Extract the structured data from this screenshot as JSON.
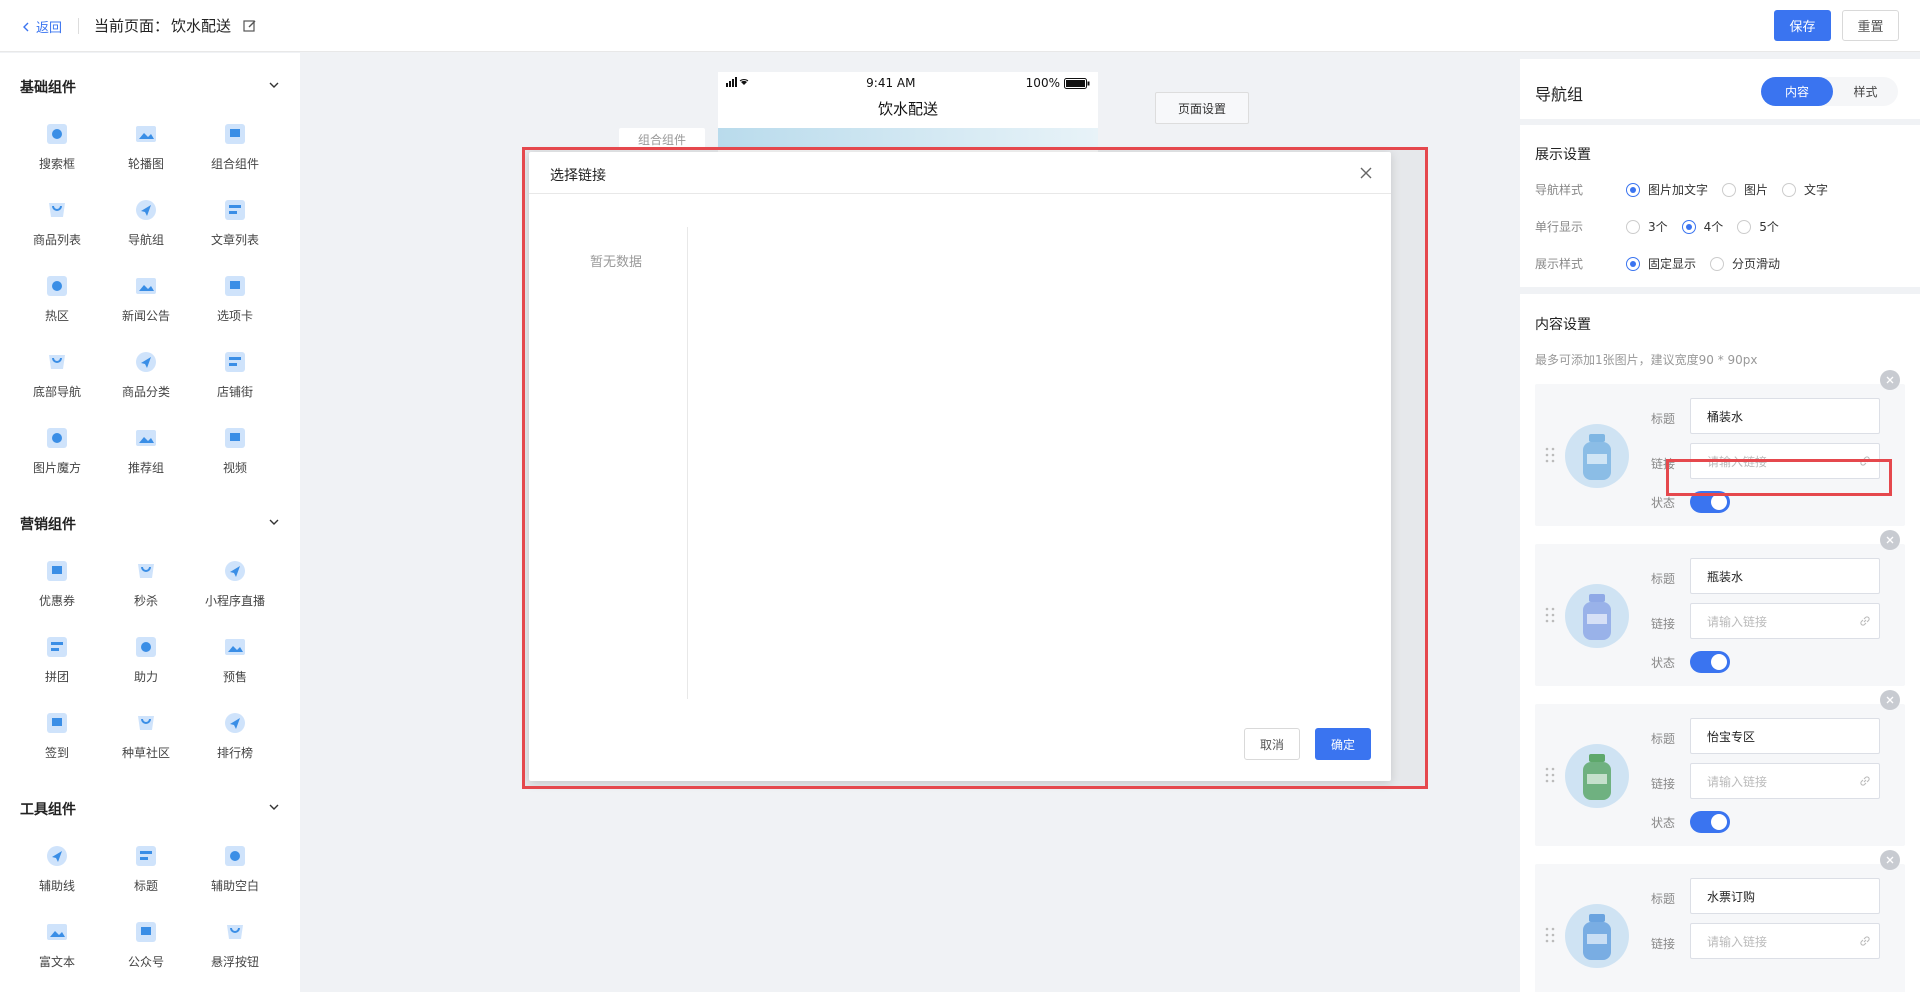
{
  "topbar": {
    "back_label": "返回",
    "page_label": "当前页面：",
    "page_name": "饮水配送",
    "save_label": "保存",
    "reset_label": "重置"
  },
  "left_panel": {
    "sections": [
      {
        "title": "基础组件",
        "items": [
          "搜索框",
          "轮播图",
          "组合组件",
          "商品列表",
          "导航组",
          "文章列表",
          "热区",
          "新闻公告",
          "选项卡",
          "底部导航",
          "商品分类",
          "店铺街",
          "图片魔方",
          "推荐组",
          "视频"
        ]
      },
      {
        "title": "营销组件",
        "items": [
          "优惠券",
          "秒杀",
          "小程序直播",
          "拼团",
          "助力",
          "预售",
          "签到",
          "种草社区",
          "排行榜"
        ]
      },
      {
        "title": "工具组件",
        "items": [
          "辅助线",
          "标题",
          "辅助空白",
          "富文本",
          "公众号",
          "悬浮按钮"
        ]
      }
    ]
  },
  "canvas": {
    "status_time": "9:41 AM",
    "status_battery": "100%",
    "phone_title": "饮水配送",
    "combo_tab": "组合组件",
    "page_settings": "页面设置"
  },
  "modal": {
    "title": "选择链接",
    "no_data": "暂无数据",
    "cancel": "取消",
    "ok": "确定"
  },
  "right_panel": {
    "title": "导航组",
    "tab_content": "内容",
    "tab_style": "样式",
    "display_settings": "展示设置",
    "nav_style_label": "导航样式",
    "nav_style_options": [
      "图片加文字",
      "图片",
      "文字"
    ],
    "nav_style_selected": 0,
    "row_display_label": "单行显示",
    "row_display_options": [
      "3个",
      "4个",
      "5个"
    ],
    "row_display_selected": 1,
    "display_mode_label": "展示样式",
    "display_mode_options": [
      "固定显示",
      "分页滑动"
    ],
    "display_mode_selected": 0,
    "content_settings": "内容设置",
    "hint": "最多可添加1张图片，建议宽度90 * 90px",
    "field_title": "标题",
    "field_link": "链接",
    "field_status": "状态",
    "link_placeholder": "请输入链接",
    "items": [
      {
        "title": "桶装水",
        "status": true
      },
      {
        "title": "瓶装水",
        "status": true
      },
      {
        "title": "怡宝专区",
        "status": true
      },
      {
        "title": "水票订购",
        "status": true
      }
    ]
  },
  "colors": {
    "accent": "#3a74f0",
    "highlight": "#e5484d"
  }
}
